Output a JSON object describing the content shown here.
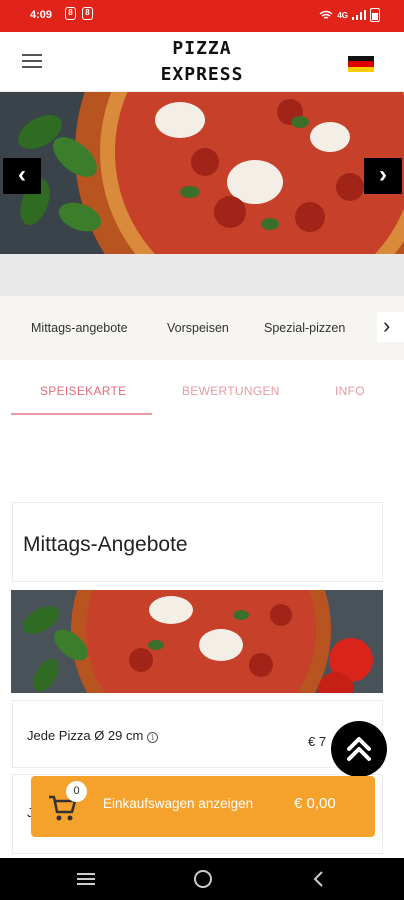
{
  "status_bar": {
    "time": "4:09",
    "notif_icons": [
      "8",
      "8"
    ],
    "network": "4G"
  },
  "header": {
    "logo_line1": "PIZZA",
    "logo_line2": "EXPRESS",
    "menu_icon": "hamburger-icon",
    "language_icon": "german-flag-icon"
  },
  "colors": {
    "status": "#e2231a",
    "accent_pink": "#e89aa0",
    "cart": "#f5a22d"
  },
  "categories": [
    "Mittags-angebote",
    "Vorspeisen",
    "Spezial-pizzen"
  ],
  "tabs": {
    "menu": "SPEISEKARTE",
    "reviews": "BEWERTUNGEN",
    "info": "INFO"
  },
  "section": {
    "title": "Mittags-Angebote"
  },
  "items": [
    {
      "name": "Jede Pizza Ø 29 cm",
      "price": "€ 7"
    },
    {
      "name": "J"
    }
  ],
  "cart": {
    "count": "0",
    "label": "Einkaufswagen anzeigen",
    "total": "€ 0,00"
  }
}
